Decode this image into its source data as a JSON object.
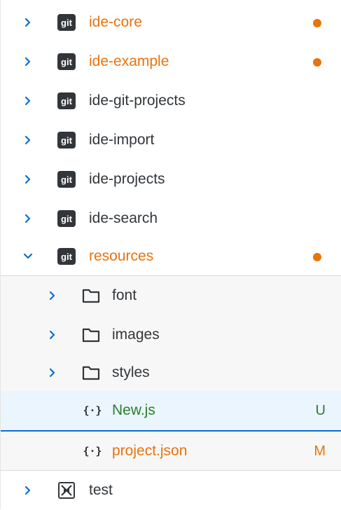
{
  "colors": {
    "modified": "#e9730c",
    "untracked": "#2b7d2b",
    "selected_bg": "#ebf5fe",
    "selected_border": "#0a6ed1",
    "sub_bg": "#f7f7f7"
  },
  "icons": {
    "git_badge_text": "git"
  },
  "tree": {
    "items": [
      {
        "label": "ide-core",
        "state": "modified",
        "indicator": "dot"
      },
      {
        "label": "ide-example",
        "state": "modified",
        "indicator": "dot"
      },
      {
        "label": "ide-git-projects"
      },
      {
        "label": "ide-import"
      },
      {
        "label": "ide-projects"
      },
      {
        "label": "ide-search"
      },
      {
        "label": "resources",
        "state": "modified",
        "indicator": "dot",
        "expanded": true
      },
      {
        "label": "font"
      },
      {
        "label": "images"
      },
      {
        "label": "styles"
      },
      {
        "label": "New.js",
        "status": "U",
        "state": "untracked"
      },
      {
        "label": "project.json",
        "status": "M",
        "state": "modified"
      },
      {
        "label": "test"
      }
    ]
  }
}
